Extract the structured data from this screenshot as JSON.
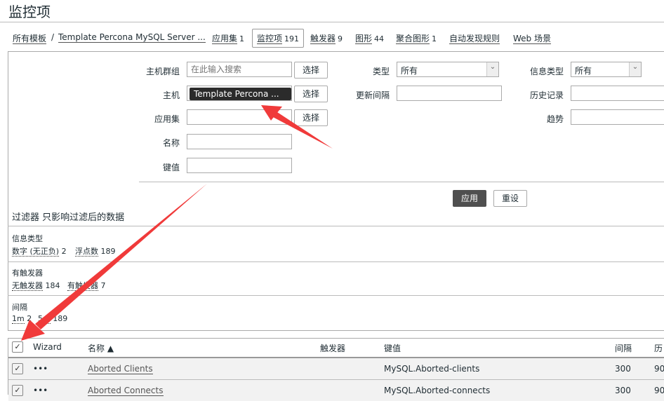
{
  "title": "监控项",
  "breadcrumb": {
    "all": "所有模板",
    "template": "Template Percona MySQL Server ..."
  },
  "tabs": [
    {
      "label": "应用集",
      "count": "1"
    },
    {
      "label": "监控项",
      "count": "191"
    },
    {
      "label": "触发器",
      "count": "9"
    },
    {
      "label": "图形",
      "count": "44"
    },
    {
      "label": "聚合图形",
      "count": "1"
    },
    {
      "label": "自动发现规则",
      "count": ""
    },
    {
      "label": "Web 场景",
      "count": ""
    }
  ],
  "filter": {
    "host_group_label": "主机群组",
    "host_group_placeholder": "在此输入搜索",
    "select": "选择",
    "host_label": "主机",
    "host_chip": "Template Percona ...",
    "app_label": "应用集",
    "name_label": "名称",
    "key_label": "键值",
    "type_label": "类型",
    "type_value": "所有",
    "interval_label": "更新间隔",
    "info_type_label": "信息类型",
    "info_type_value": "所有",
    "history_label": "历史记录",
    "trends_label": "趋势",
    "apply": "应用",
    "reset": "重设"
  },
  "subfilter": {
    "title": "过滤器 只影响过滤后的数据",
    "groups": [
      {
        "label": "信息类型",
        "items": [
          {
            "name": "数字 (无正负)",
            "count": "2"
          },
          {
            "name": "浮点数",
            "count": "189"
          }
        ]
      },
      {
        "label": "有触发器",
        "items": [
          {
            "name": "无触发器",
            "count": "184"
          },
          {
            "name": "有触发器",
            "count": "7"
          }
        ]
      },
      {
        "label": "间隔",
        "items": [
          {
            "name": "1m",
            "count": "2"
          },
          {
            "name": "5m",
            "count": "189"
          }
        ]
      }
    ]
  },
  "table": {
    "headers": {
      "wizard": "Wizard",
      "name": "名称 ▲",
      "triggers": "触发器",
      "key": "键值",
      "interval": "间隔",
      "history": "历"
    },
    "rows": [
      {
        "wizard": "•••",
        "name": "Aborted Clients",
        "key": "MySQL.Aborted-clients",
        "interval": "300",
        "history": "90"
      },
      {
        "wizard": "•••",
        "name": "Aborted Connects",
        "key": "MySQL.Aborted-connects",
        "interval": "300",
        "history": "90"
      }
    ]
  },
  "colors": {
    "annotation_arrow": "#f03a3a",
    "apply_button": "#4f4f4f",
    "row_bg": "#f2f2f2"
  }
}
